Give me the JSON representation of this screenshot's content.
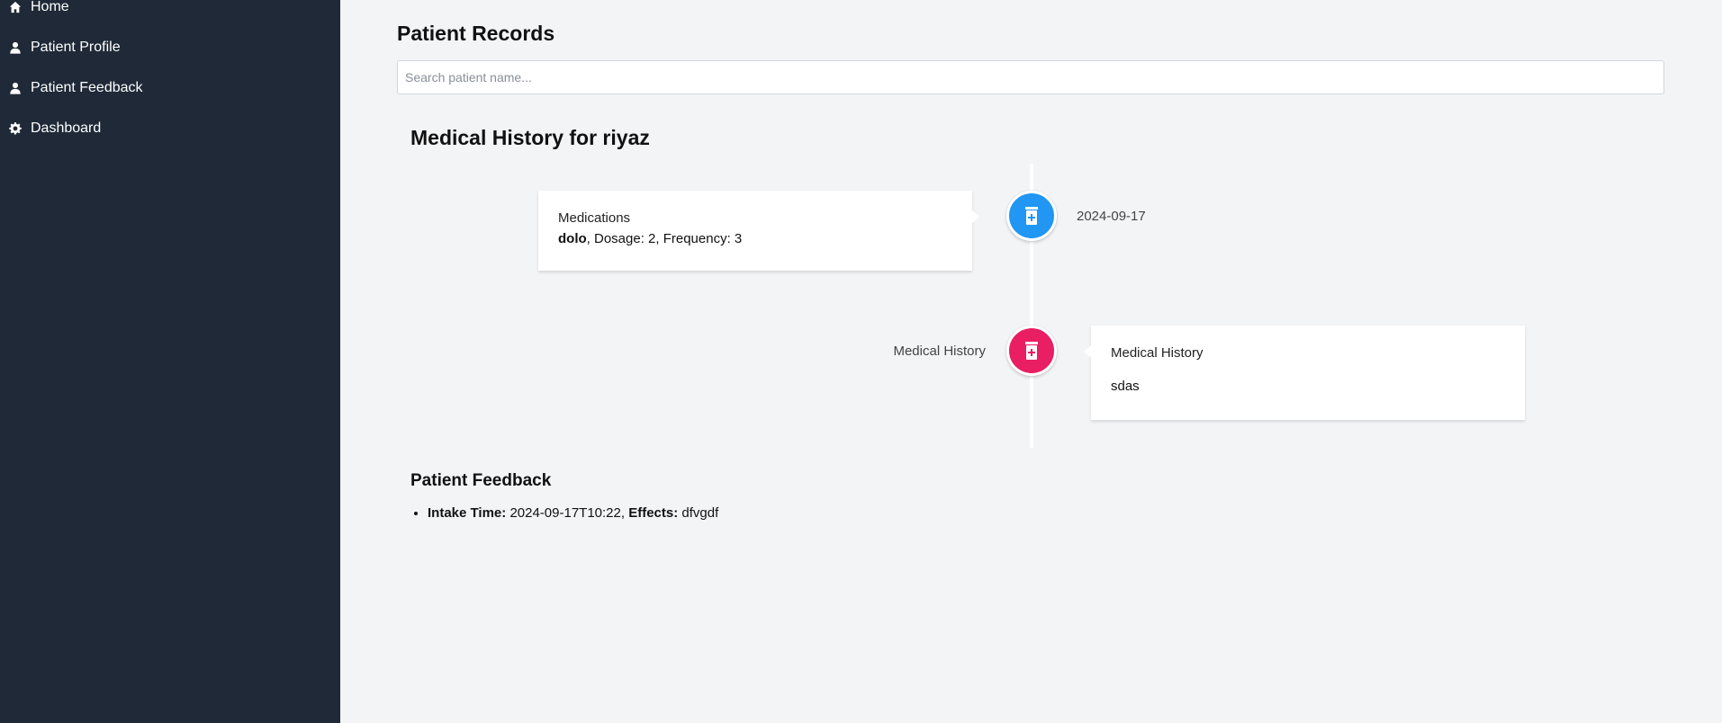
{
  "sidebar": {
    "items": [
      {
        "label": "Home",
        "icon": "home-icon"
      },
      {
        "label": "Patient Profile",
        "icon": "user-icon"
      },
      {
        "label": "Patient Feedback",
        "icon": "user-icon"
      },
      {
        "label": "Dashboard",
        "icon": "gear-icon"
      }
    ]
  },
  "main": {
    "title": "Patient Records",
    "search": {
      "placeholder": "Search patient name...",
      "value": ""
    },
    "history_title": "Medical History for riyaz",
    "timeline": [
      {
        "heading": "Medications",
        "name": "dolo",
        "details": ", Dosage: 2, Frequency: 3",
        "date": "2024-09-17",
        "icon": "prescription-bottle-icon",
        "icon_color": "#2196f3"
      },
      {
        "heading": "Medical History",
        "body": "sdas",
        "date": "Medical History",
        "icon": "prescription-bottle-icon",
        "icon_color": "#e91e63"
      }
    ],
    "feedback": {
      "title": "Patient Feedback",
      "items": [
        {
          "intake_label": "Intake Time:",
          "intake_value": "2024-09-17T10:22,",
          "effects_label": "Effects:",
          "effects_value": "dfvgdf"
        }
      ]
    }
  },
  "colors": {
    "sidebar_bg": "#1f2937",
    "page_bg": "#f3f4f6",
    "medication_icon": "#2196f3",
    "history_icon": "#e91e63"
  }
}
